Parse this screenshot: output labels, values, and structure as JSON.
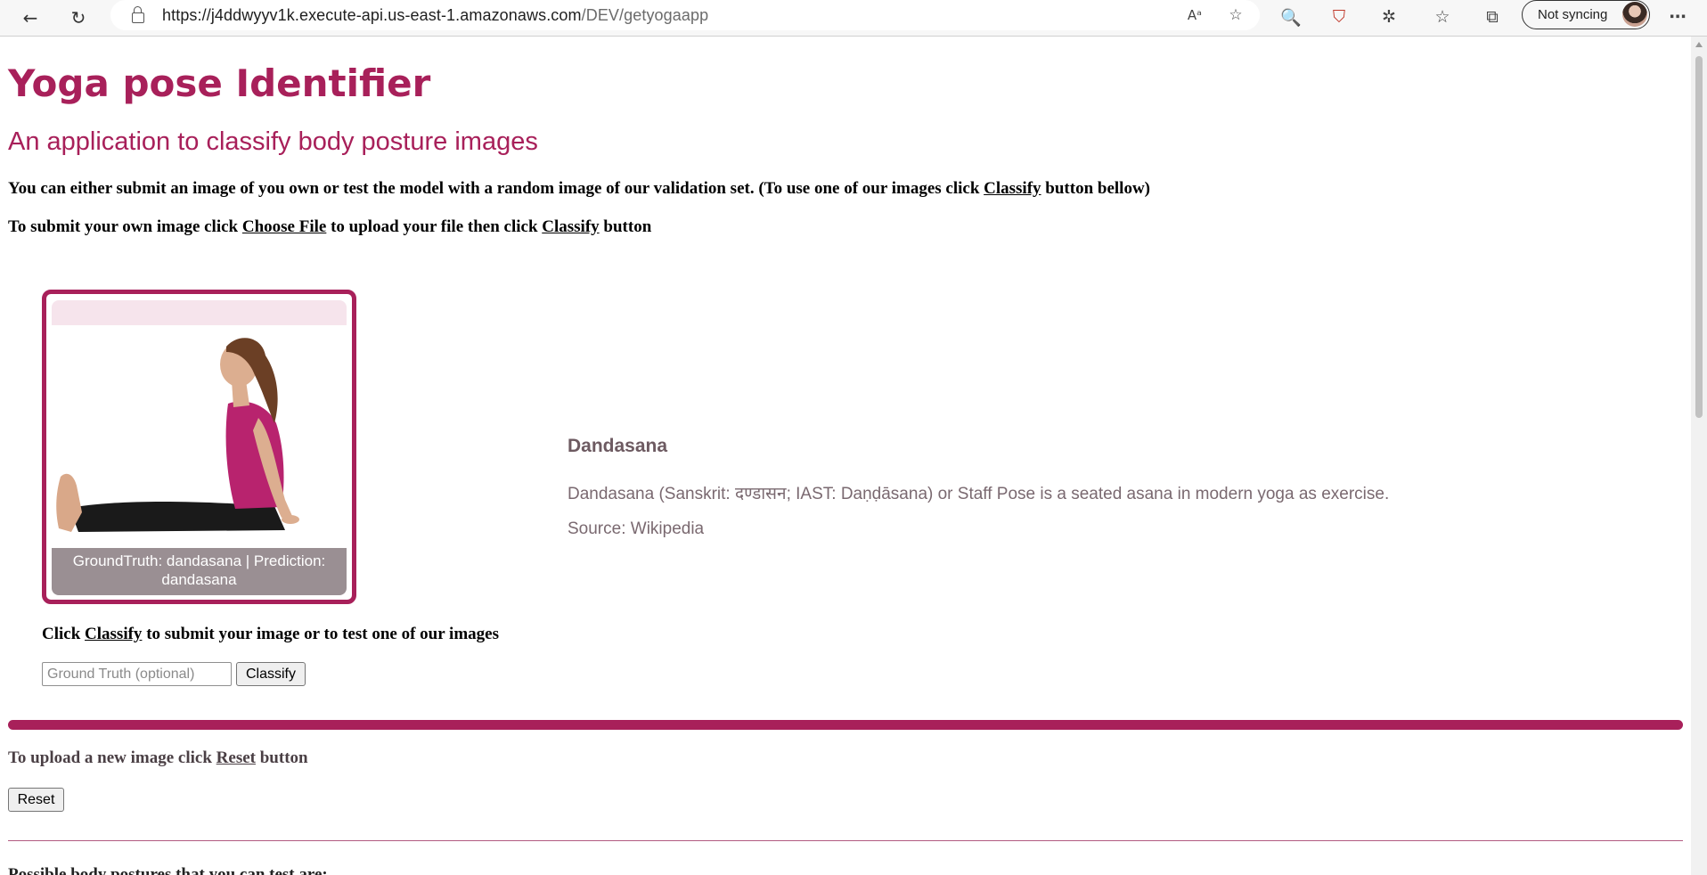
{
  "browser": {
    "url_host": "https://j4ddwyyv1k.execute-api.us-east-1.amazonaws.com",
    "url_path": "/DEV/getyogaapp",
    "sync_label": "Not syncing"
  },
  "page": {
    "title": "Yoga pose Identifier",
    "subtitle": "An application to classify body posture images",
    "instruction1": {
      "before": "You can either submit an image of you own or test the model with a random image of our validation set. (To use one of our images click ",
      "link": "Classify",
      "after": " button bellow)"
    },
    "instruction2": {
      "before": "To submit your own image click ",
      "link1": "Choose File",
      "middle": " to upload your file then click ",
      "link2": "Classify",
      "after": " button"
    },
    "card": {
      "caption": "GroundTruth: dandasana | Prediction: dandasana"
    },
    "pose": {
      "name": "Dandasana",
      "description": "Dandasana (Sanskrit: दण्डासन; IAST: Daṇḍāsana) or Staff Pose is a seated asana in modern yoga as exercise.",
      "source": "Source: Wikipedia"
    },
    "classify_instruction": {
      "before": "Click ",
      "link": "Classify",
      "after": " to submit your image or to test one of our images"
    },
    "ground_truth_placeholder": "Ground Truth (optional)",
    "classify_button": "Classify",
    "reset_instruction": {
      "before": "To upload a new image click ",
      "link": "Reset",
      "after": " button"
    },
    "reset_button": "Reset",
    "cut_off_text": "Possible body postures that you can test are:"
  },
  "colors": {
    "accent": "#a8205a"
  }
}
